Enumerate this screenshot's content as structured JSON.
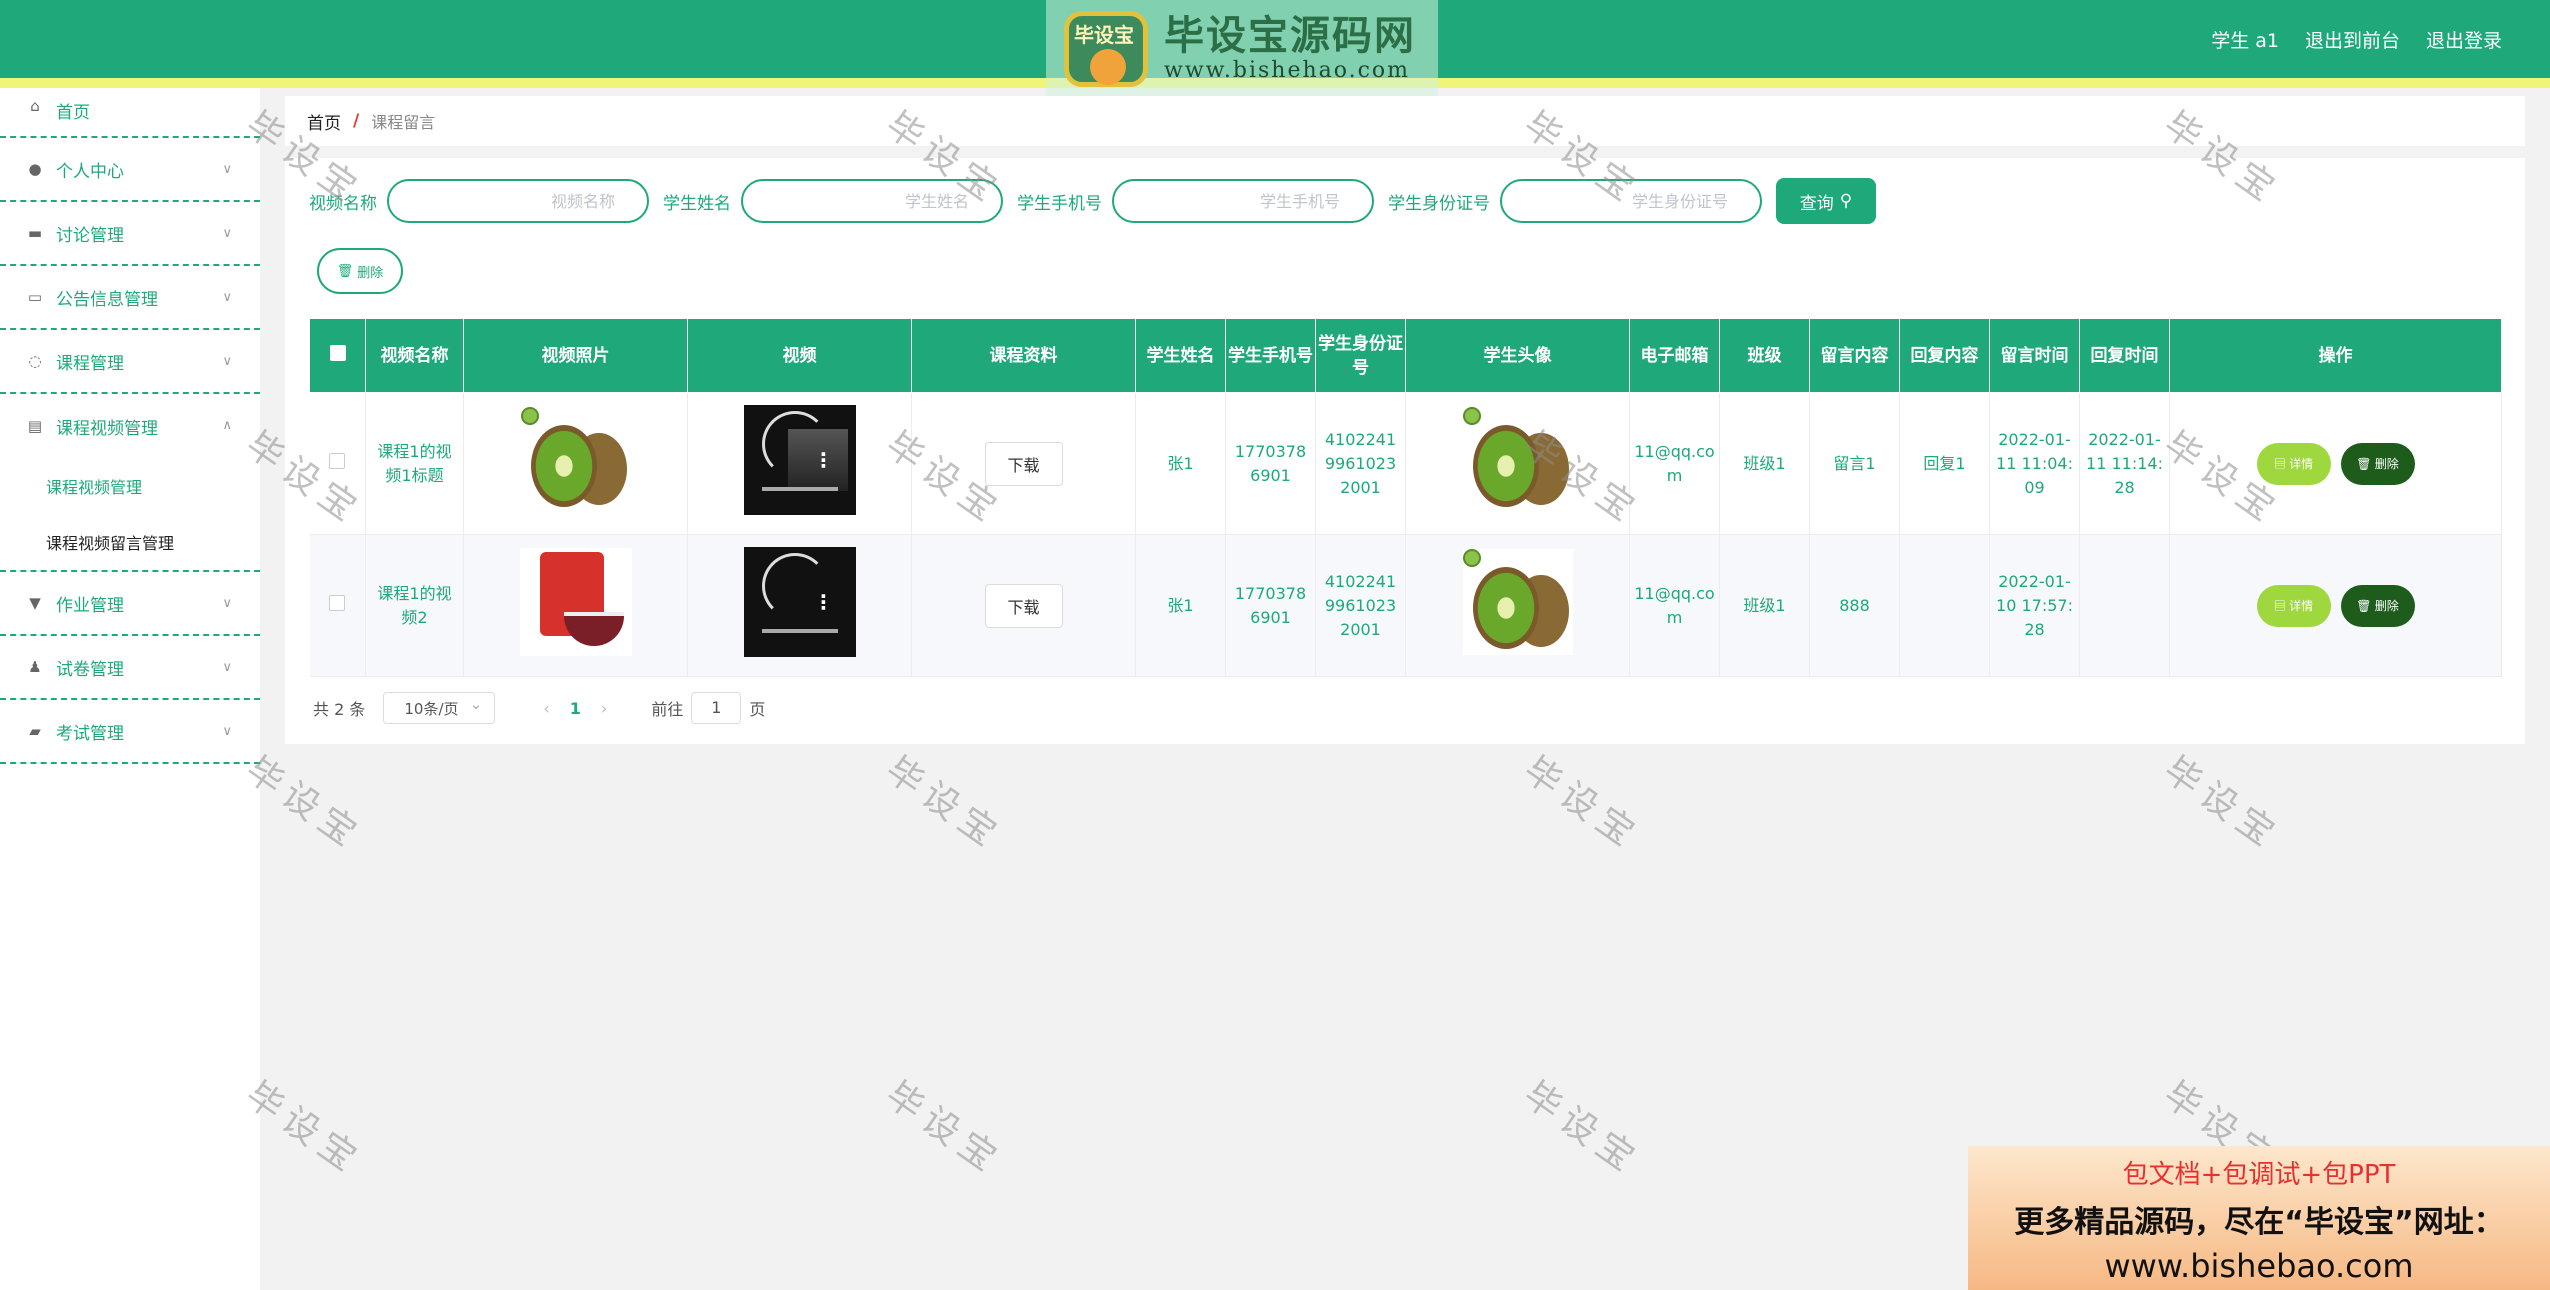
{
  "header": {
    "logo_badge": "毕设宝",
    "logo_cn": "毕设宝源码网",
    "logo_url": "www.bishehao.com",
    "user": "学生 a1",
    "back_front": "退出到前台",
    "logout": "退出登录"
  },
  "sidebar": {
    "items": [
      {
        "label": "首页",
        "icon": "home-icon"
      },
      {
        "label": "个人中心",
        "icon": "user-icon"
      },
      {
        "label": "讨论管理",
        "icon": "briefcase-icon"
      },
      {
        "label": "公告信息管理",
        "icon": "card-icon"
      },
      {
        "label": "课程管理",
        "icon": "power-icon"
      },
      {
        "label": "课程视频管理",
        "icon": "clipboard-icon"
      },
      {
        "label": "作业管理",
        "icon": "stamp-icon"
      },
      {
        "label": "试卷管理",
        "icon": "person-icon"
      },
      {
        "label": "考试管理",
        "icon": "ticket-icon"
      }
    ],
    "sub": [
      "课程视频管理",
      "课程视频留言管理"
    ]
  },
  "breadcrumb": {
    "home": "首页",
    "sep": "/",
    "current": "课程留言"
  },
  "search": {
    "f1_label": "视频名称",
    "f1_ph": "视频名称",
    "f2_label": "学生姓名",
    "f2_ph": "学生姓名",
    "f3_label": "学生手机号",
    "f3_ph": "学生手机号",
    "f4_label": "学生身份证号",
    "f4_ph": "学生身份证号",
    "query": "查询"
  },
  "delete_top": "删除",
  "table": {
    "headers": [
      "视频名称",
      "视频照片",
      "视频",
      "课程资料",
      "学生姓名",
      "学生手机号",
      "学生身份证号",
      "学生头像",
      "电子邮箱",
      "班级",
      "留言内容",
      "回复内容",
      "留言时间",
      "回复时间",
      "操作"
    ],
    "rows": [
      {
        "name": "课程1的视频1标题",
        "download": "下载",
        "student": "张1",
        "phone": "17703786901",
        "idcard": "410224199610232001",
        "email": "11@qq.com",
        "class": "班级1",
        "message": "留言1",
        "reply": "回复1",
        "msg_time": "2022-01-11 11:04:09",
        "reply_time": "2022-01-11 11:14:28",
        "detail": "详情",
        "delete": "删除"
      },
      {
        "name": "课程1的视频2",
        "download": "下载",
        "student": "张1",
        "phone": "17703786901",
        "idcard": "410224199610232001",
        "email": "11@qq.com",
        "class": "班级1",
        "message": "888",
        "reply": "",
        "msg_time": "2022-01-10 17:57:28",
        "reply_time": "",
        "detail": "详情",
        "delete": "删除"
      }
    ]
  },
  "pager": {
    "total": "共 2 条",
    "size": "10条/页",
    "prev": "‹",
    "page": "1",
    "next": "›",
    "goto": "前往",
    "goto_val": "1",
    "unit": "页"
  },
  "watermark": "毕设宝",
  "ad": {
    "l1": "包文档+包调试+包PPT",
    "l2": "更多精品源码，尽在“毕设宝”网址：",
    "l3": "www.bishebao.com"
  }
}
